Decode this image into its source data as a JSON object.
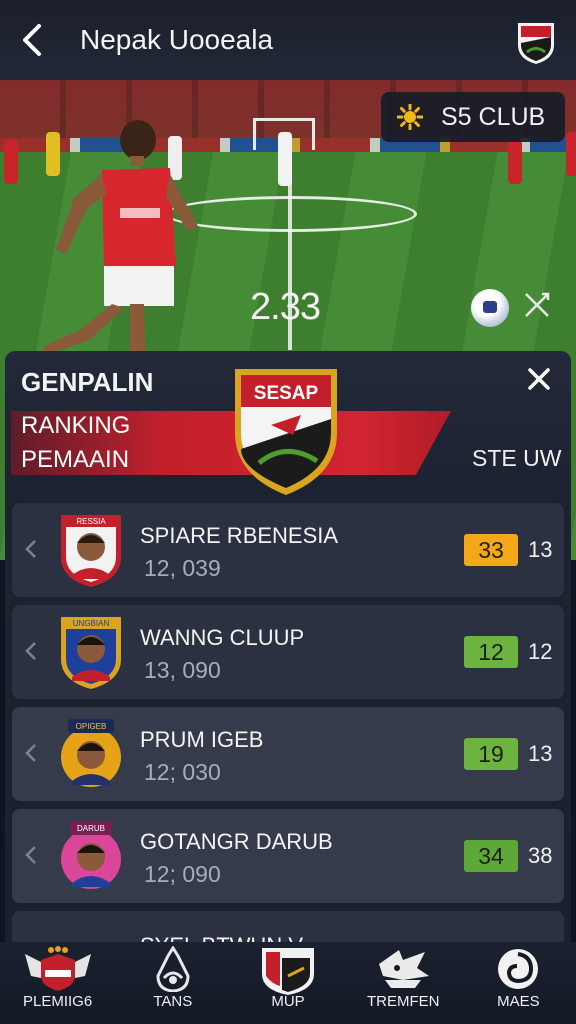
{
  "header": {
    "title": "Nepak Uooeala",
    "back_icon": "back-arrow-icon",
    "logo_icon": "club-crest-icon"
  },
  "club_pill": {
    "label": "S5 CLUB",
    "icon": "sun-icon"
  },
  "match": {
    "score_text": "2.33"
  },
  "panel": {
    "title": "GENPALIN",
    "ranking_line1": "RANKING",
    "ranking_line2": "PEMAAIN",
    "crest_text": "SESAP",
    "side_label": "STE UW",
    "rows": [
      {
        "name": "SPIARE RBENESIA",
        "number": "12, 039",
        "score": "33",
        "score_color": "#f2a818",
        "count": "13",
        "badge_text": "RESSIA",
        "badge_color": "#c3202c"
      },
      {
        "name": "WANNG CLUUP",
        "number": "13, 090",
        "score": "12",
        "score_color": "#6db33f",
        "count": "12",
        "badge_text": "UNGBIAN",
        "badge_color": "#1e3f9a"
      },
      {
        "name": "PRUM IGEB",
        "number": "12; 030",
        "score": "19",
        "score_color": "#6db33f",
        "count": "13",
        "badge_text": "OPIGEB",
        "badge_color": "#e7a318"
      },
      {
        "name": "GOTANGR DARUB",
        "number": "12; 090",
        "score": "34",
        "score_color": "#5ea83a",
        "count": "38",
        "badge_text": "DARUB",
        "badge_color": "#d9469a"
      }
    ],
    "partial_row_name": "SYEL BTWUN V"
  },
  "bottom_nav": [
    {
      "label": "PLEMIIG6",
      "icon": "wings-crest-icon"
    },
    {
      "label": "TANS",
      "icon": "emblem-icon"
    },
    {
      "label": "MUP",
      "icon": "shield-icon"
    },
    {
      "label": "TREMFEN",
      "icon": "ship-icon"
    },
    {
      "label": "MAES",
      "icon": "spiral-icon"
    }
  ]
}
